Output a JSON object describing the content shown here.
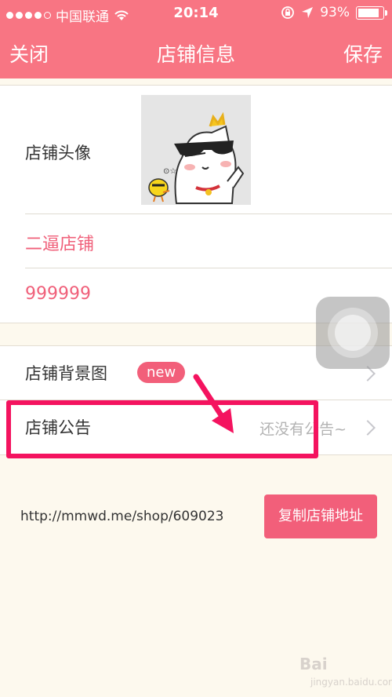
{
  "status_bar": {
    "carrier": "中国联通",
    "time": "20:14",
    "battery": "93%",
    "battery_level": 0.93
  },
  "nav": {
    "close_label": "关闭",
    "title": "店铺信息",
    "save_label": "保存"
  },
  "shop": {
    "avatar_label": "店铺头像",
    "avatar_icon": "cartoon-cat-with-sunglasses",
    "name": "二逼店铺",
    "wechat": "999999"
  },
  "settings": {
    "background_label": "店铺背景图",
    "new_badge": "new",
    "notice_label": "店铺公告",
    "notice_value": "还没有公告~"
  },
  "shop_url": {
    "url": "http://mmwd.me/shop/609023",
    "copy_label": "复制店铺地址"
  },
  "watermark": {
    "brand": "Bai",
    "sub": "jingyan.baidu.com"
  },
  "colors": {
    "accent": "#f87583",
    "highlight": "#f4135f",
    "pink_text": "#f0607a"
  }
}
